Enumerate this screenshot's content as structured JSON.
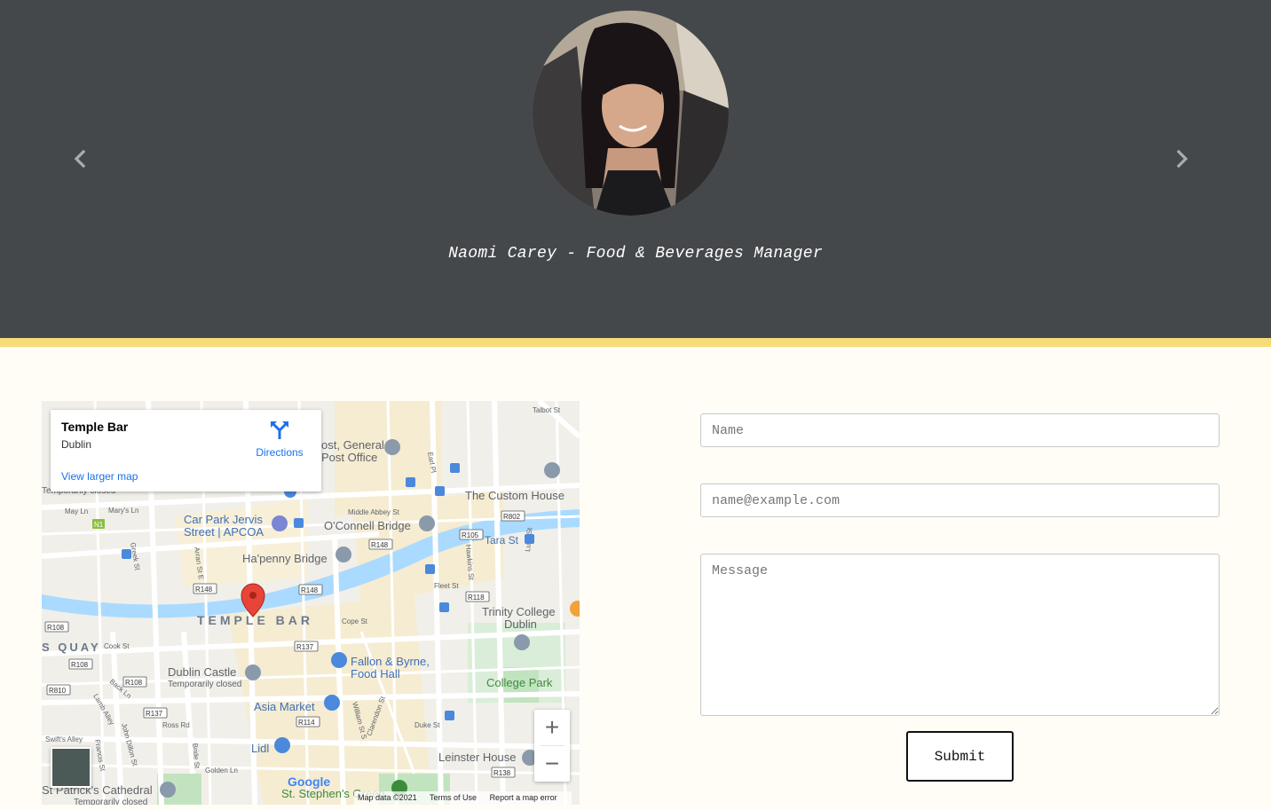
{
  "carousel": {
    "caption": "Naomi Carey - Food & Beverages Manager",
    "prev_icon": "chevron-left-icon",
    "next_icon": "chevron-right-icon"
  },
  "colors": {
    "hero_bg": "#45484b",
    "accent_border": "#f6dc78",
    "page_bg": "#fffdf6",
    "link_blue": "#1a73e8"
  },
  "map": {
    "card": {
      "place": "Temple Bar",
      "subtitle": "Dublin",
      "directions": "Directions",
      "view_larger": "View larger map"
    },
    "labels": {
      "temple_bar": "TEMPLE BAR",
      "quay": "S QUAY",
      "custom_house": "The Custom House",
      "oconnell_bridge": "O'Connell Bridge",
      "hapenny_bridge": "Ha'penny Bridge",
      "car_park_1": "Car Park Jervis",
      "car_park_2": "Street | APCOA",
      "gpo_1": "ost, General",
      "gpo_2": "Post Office",
      "tara_st": "Tara St",
      "trinity_1": "Trinity College",
      "trinity_2": "Dublin",
      "fallon_1": "Fallon & Byrne,",
      "fallon_2": "Food Hall",
      "dublin_castle": "Dublin Castle",
      "temp_closed": "Temporarily closed",
      "temp_closed_top": "Temporarily closed",
      "college_park": "College Park",
      "asia_market": "Asia Market",
      "lidl": "Lidl",
      "leinster_house": "Leinster House",
      "st_patricks": "St Patrick's Cathedral",
      "temp_closed_bottom": "Temporarily closed",
      "st_stephens": "St. Stephen's Green",
      "talbot_st": "Talbot St",
      "middle_abbey": "Middle Abbey St",
      "may_ln": "May Ln",
      "marys_ln": "Mary's Ln",
      "greek_st": "Greek St",
      "arran_st": "Arran St E",
      "fleet_st": "Fleet St",
      "cope_st": "Cope St",
      "cook_st": "Cook St",
      "back_ln": "Back Ln",
      "ross_rd": "Ross Rd",
      "lamb_alley": "Lamb Alley",
      "john_dillon": "John Dillon St",
      "francis_st": "Francis St",
      "swifts_alley": "Swift's Alley",
      "bride_st": "Bride St",
      "golden_ln": "Golden Ln",
      "william_st": "William St S",
      "clarendon": "Clarendon St",
      "duke_st": "Duke St",
      "hawkins": "Hawkins St",
      "luke_st": "Luke St",
      "earl_pl": "Earl Pl",
      "r802": "R802",
      "r105": "R105",
      "r148a": "R148",
      "r148b": "R148",
      "r148c": "R148",
      "r118": "R118",
      "r137a": "R137",
      "r137b": "R137",
      "r108a": "R108",
      "r108b": "R108",
      "r108c": "R108",
      "r810": "R810",
      "r114": "R114",
      "r138": "R138",
      "n1": "N1"
    },
    "google": "Google",
    "attribution": {
      "map_data": "Map data ©2021",
      "terms": "Terms of Use",
      "report": "Report a map error"
    },
    "zoom_in": "+",
    "zoom_out": "−"
  },
  "form": {
    "name_placeholder": "Name",
    "email_placeholder": "name@example.com",
    "message_placeholder": "Message",
    "submit_label": "Submit"
  }
}
